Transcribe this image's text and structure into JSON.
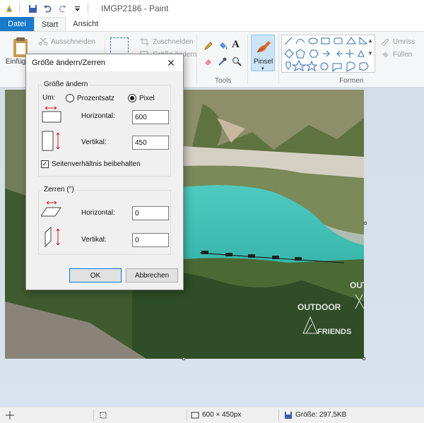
{
  "window": {
    "title": "IMGP2186 - Paint"
  },
  "tabs": [
    "Datei",
    "Start",
    "Ansicht"
  ],
  "ribbon": {
    "clipboard": {
      "paste_label": "Einfüg",
      "cut_label": "Ausschneiden"
    },
    "image": {
      "crop_label": "Zuschneiden",
      "resize_label": "Größe ändern"
    },
    "tools_label": "Tools",
    "brush_label": "Pinsel",
    "shapes": {
      "label": "Formen",
      "outline_label": "Umriss",
      "fill_label": "Füllen"
    }
  },
  "dialog": {
    "title": "Größe ändern/Zerren",
    "resize_group": {
      "legend": "Größe ändern",
      "by_label": "Um:",
      "percent_label": "Prozentsatz",
      "pixel_label": "Pixel",
      "selected": "Pixel",
      "horizontal_label": "Horizontal:",
      "horizontal_value": "600",
      "vertical_label": "Vertikal:",
      "vertical_value": "450",
      "keep_ratio_label": "Seitenverhältnis beibehalten",
      "keep_ratio_checked": true
    },
    "skew_group": {
      "legend": "Zerren (°)",
      "horizontal_label": "Horizontal:",
      "horizontal_value": "0",
      "vertical_label": "Vertikal:",
      "vertical_value": "0"
    },
    "ok_label": "OK",
    "cancel_label": "Abbrechen"
  },
  "image_watermark": {
    "line1": "OUTDOOR",
    "line2": "FRIENDS"
  },
  "statusbar": {
    "dimensions": "600 × 450px",
    "size": "Größe: 297,5KB"
  },
  "colors": {
    "accent": "#1979ca",
    "lake": "#3fbfb4"
  }
}
